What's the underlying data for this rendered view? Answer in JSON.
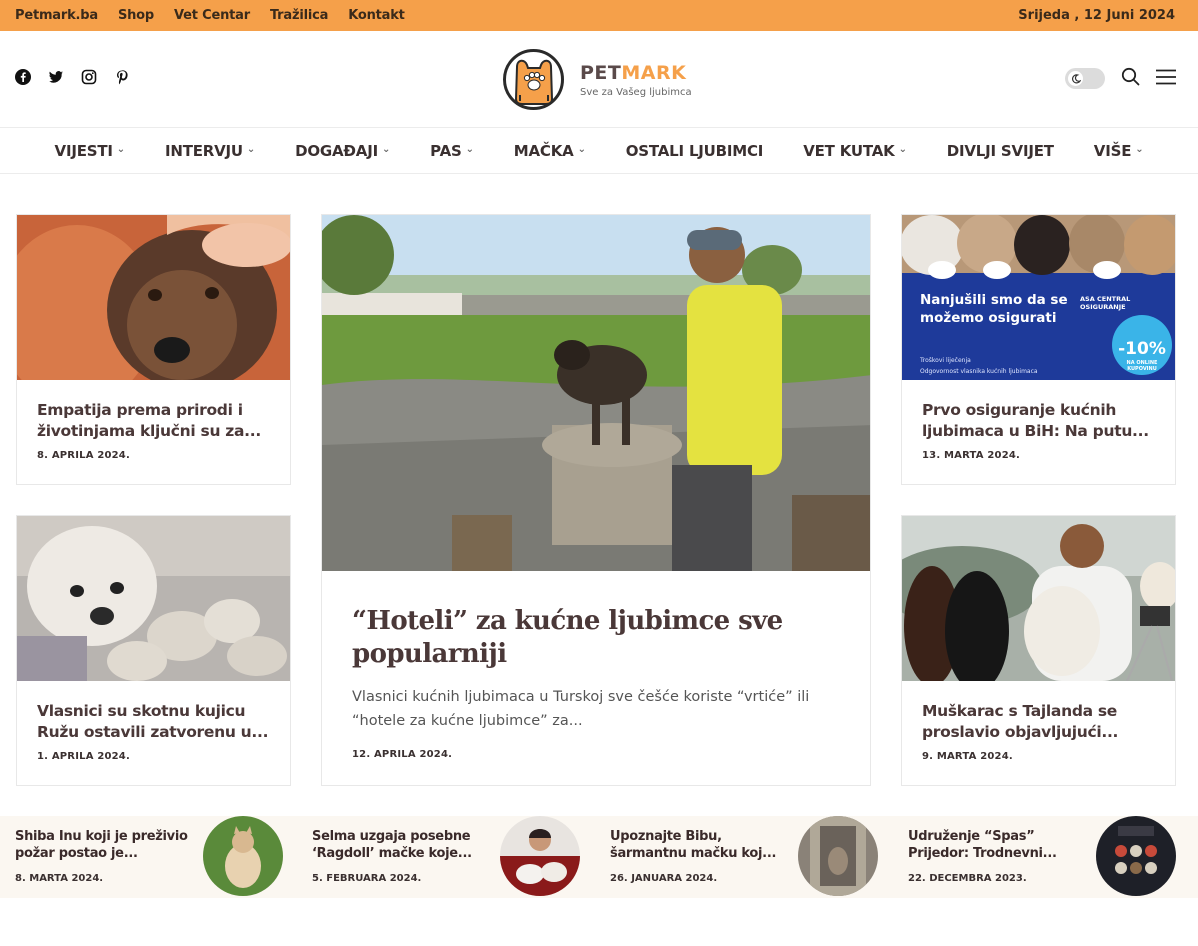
{
  "topbar": {
    "links": [
      "Petmark.ba",
      "Shop",
      "Vet Centar",
      "Tražilica",
      "Kontakt"
    ],
    "date": "Srijeda , 12 Juni 2024"
  },
  "social": [
    "facebook-icon",
    "twitter-icon",
    "instagram-icon",
    "pinterest-icon"
  ],
  "logo": {
    "name_part1": "PET",
    "name_part2": "MARK",
    "tagline": "Sve za Vašeg ljubimca"
  },
  "nav": {
    "items": [
      {
        "label": "VIJESTI",
        "dropdown": true
      },
      {
        "label": "INTERVJU",
        "dropdown": true
      },
      {
        "label": "DOGAĐAJI",
        "dropdown": true
      },
      {
        "label": "PAS",
        "dropdown": true
      },
      {
        "label": "MAČKA",
        "dropdown": true
      },
      {
        "label": "OSTALI LJUBIMCI",
        "dropdown": false
      },
      {
        "label": "VET KUTAK",
        "dropdown": true
      },
      {
        "label": "DIVLJI SVIJET",
        "dropdown": false
      },
      {
        "label": "VIŠE",
        "dropdown": true
      }
    ]
  },
  "cards": {
    "left_top": {
      "title": "Empatija prema prirodi i životinjama ključni su za...",
      "date": "8. APRILA 2024."
    },
    "left_bottom": {
      "title": "Vlasnici su skotnu kujicu Ružu ostavili zatvorenu u...",
      "date": "1. APRILA 2024."
    },
    "right_top": {
      "title": "Prvo osiguranje kućnih ljubimaca u BiH: Na putu...",
      "date": "13. MARTA 2024."
    },
    "right_bottom": {
      "title": "Muškarac s Tajlanda se proslavio objavljujući...",
      "date": "9. MARTA 2024."
    }
  },
  "ad": {
    "headline": "Nanjušili smo da se možemo osigurati",
    "brand": "ASA CENTRAL OSIGURANJE",
    "bullets": [
      "Troškovi liječenja",
      "Odgovornost vlasnika kućnih ljubimaca"
    ],
    "badge_value": "-10%",
    "badge_sub": "NA ONLINE KUPOVINU"
  },
  "feature": {
    "title": "“Hoteli” za kućne ljubimce sve popularniji",
    "excerpt": "Vlasnici kućnih ljubimaca u Turskoj sve češće koriste “vrtiće” ili “hotele za kućne ljubimce” za...",
    "date": "12. APRILA 2024."
  },
  "strip": [
    {
      "title": "Shiba Inu koji je preživio požar postao je...",
      "date": "8. MARTA 2024."
    },
    {
      "title": "Selma uzgaja posebne ‘Ragdoll’ mačke koje...",
      "date": "5. FEBRUARA 2024."
    },
    {
      "title": "Upoznajte Bibu, šarmantnu mačku koj...",
      "date": "26. JANUARA 2024."
    },
    {
      "title": "Udruženje “Spas” Prijedor: Trodnevni...",
      "date": "22. DECEMBRA 2023."
    }
  ]
}
